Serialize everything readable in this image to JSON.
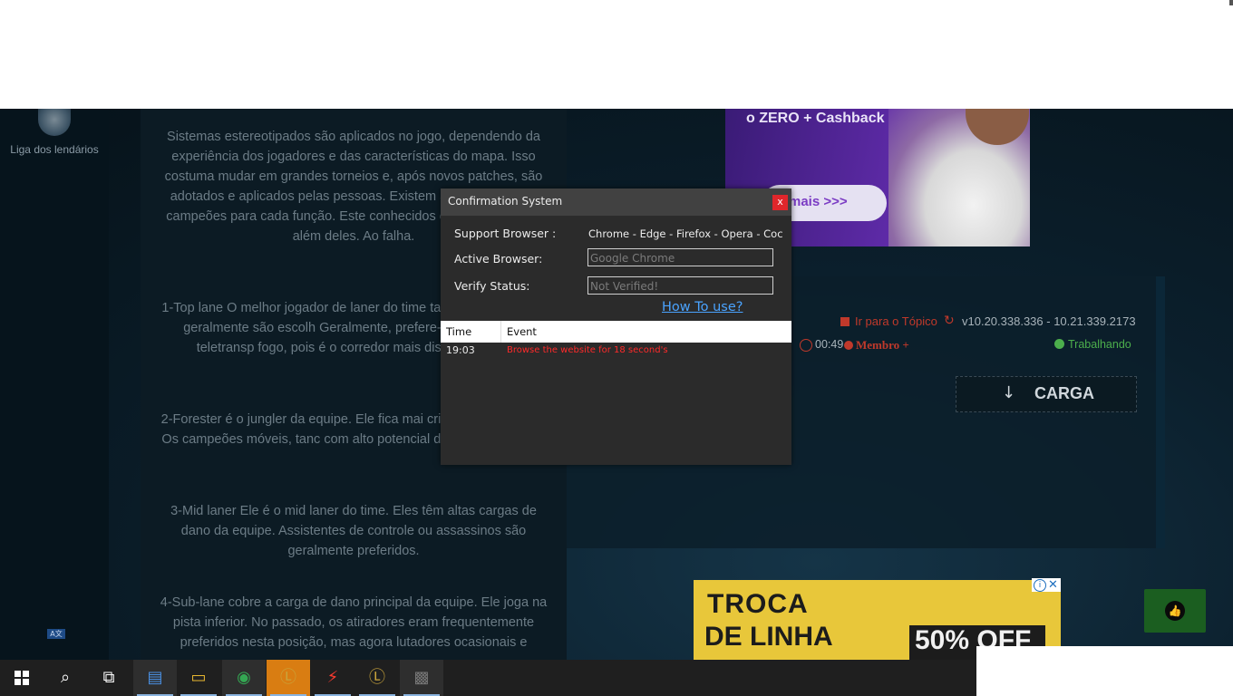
{
  "sidebar": {
    "avatar_label": "Liga dos lendários",
    "lang_badge": "A文"
  },
  "article": {
    "paragraphs": [
      "Sistemas estereotipados são aplicados no jogo, dependendo da experiência dos jogadores e das características do mapa. Isso costuma mudar em grandes torneios e, após novos patches, são adotados e aplicados pelas pessoas. Existem 5 t jogo. Existem campeões para cada função. Este conhecidos e dificilmente vão além deles. Ao falha.",
      "1-Top lane O melhor jogador de laner do time tanques e lutadores geralmente são escolh Geralmente, prefere-se a magia de teletransp fogo, pois é o corredor mais distante de out",
      "2-Forester é o jungler da equipe. Ele fica mai criaturas da floresta. Os campeões móveis, tanc com alto potencial de ataque são os p",
      "3-Mid laner Ele é o mid laner do time. Eles têm altas cargas de dano da equipe. Assistentes de controle ou assassinos são geralmente preferidos.",
      "4-Sub-lane cobre a carga de dano principal da equipe. Ele joga na pista inferior. No passado, os atiradores eram frequentemente preferidos nesta posição, mas agora lutadores ocasionais e"
    ]
  },
  "ad_top": {
    "headline": "o ZERO + Cashback",
    "cta": "mais >>>"
  },
  "topic": {
    "link": "Ir para o Tópico",
    "version": "v10.20.338.336 - 10.21.339.2173",
    "time": "00:49",
    "member": "Membro +",
    "status": "Trabalhando",
    "download_label": "CARGA"
  },
  "ad_bottom": {
    "line1": "TROCA",
    "line2": "DE LINHA",
    "discount": "50% OFF"
  },
  "dialog": {
    "title": "Confirmation System",
    "close_label": "x",
    "support_label": "Support Browser :",
    "support_value": "Chrome - Edge - Firefox - Opera - Coc",
    "active_label": "Active Browser:",
    "active_value": "Google Chrome",
    "verify_label": "Verify Status:",
    "verify_value": "Not Verified!",
    "howto": "How To use?",
    "log_columns": [
      "Time",
      "Event"
    ],
    "log_rows": [
      {
        "time": "19:03",
        "event": "Browse the website for 18 second's"
      }
    ]
  },
  "taskbar": {
    "items": [
      "start-icon",
      "search-icon",
      "task-view-icon",
      "news-app-icon",
      "file-explorer-icon",
      "chrome-icon",
      "league-client-icon",
      "bolt-app-icon",
      "league-game-icon",
      "app-window-icon"
    ]
  },
  "colors": {
    "accent_red": "#c0392b",
    "status_green": "#4cae4c",
    "dialog_bg": "#2b2b2b",
    "link_blue": "#4aa3ff"
  }
}
